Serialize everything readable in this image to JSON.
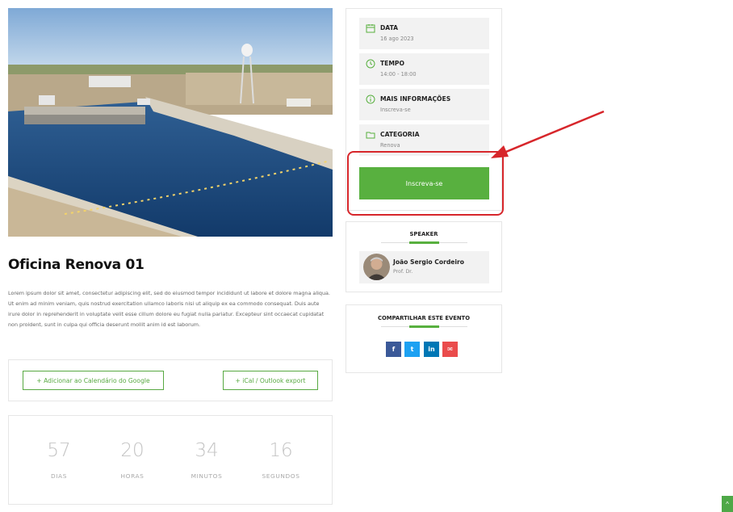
{
  "event": {
    "title": "Oficina Renova 01",
    "description": "Lorem ipsum dolor sit amet, consectetur adipiscing elit, sed do eiusmod tempor incididunt ut labore et dolore magna aliqua. Ut enim ad minim veniam, quis nostrud exercitation ullamco laboris nisi ut aliquip ex ea commodo consequat. Duis aute irure dolor in reprehenderit in voluptate velit esse cillum dolore eu fugiat nulla pariatur. Excepteur sint occaecat cupidatat non proident, sunt in culpa qui officia deserunt mollit anim id est laborum."
  },
  "calendar": {
    "google_label": "+ Adicionar ao Calendário do Google",
    "ical_label": "+ iCal / Outlook export"
  },
  "countdown": [
    {
      "value": "57",
      "label": "DIAS"
    },
    {
      "value": "20",
      "label": "HORAS"
    },
    {
      "value": "34",
      "label": "MINUTOS"
    },
    {
      "value": "16",
      "label": "SEGUNDOS"
    }
  ],
  "details": [
    {
      "title": "DATA",
      "value": "16 ago 2023",
      "icon": "calendar-icon"
    },
    {
      "title": "TEMPO",
      "value": "14:00 - 18:00",
      "icon": "clock-icon"
    },
    {
      "title": "MAIS INFORMAÇÕES",
      "value": "Inscreva-se",
      "icon": "info-icon"
    },
    {
      "title": "CATEGORIA",
      "value": "Renova",
      "icon": "folder-icon"
    }
  ],
  "register_button": "Inscreva-se",
  "speaker": {
    "heading": "SPEAKER",
    "name": "João Sergio Cordeiro",
    "role": "Prof. Dr."
  },
  "share": {
    "heading": "COMPARTILHAR ESTE EVENTO",
    "buttons": [
      {
        "glyph": "f",
        "icon": "facebook-icon",
        "color": "#3b5998"
      },
      {
        "glyph": "t",
        "icon": "twitter-icon",
        "color": "#1da1f2"
      },
      {
        "glyph": "in",
        "icon": "linkedin-icon",
        "color": "#0077b5"
      },
      {
        "glyph": "✉",
        "icon": "email-icon",
        "color": "#ea4c4c"
      }
    ]
  },
  "colors": {
    "accent": "#58b03f",
    "annotation": "#d7262b"
  }
}
